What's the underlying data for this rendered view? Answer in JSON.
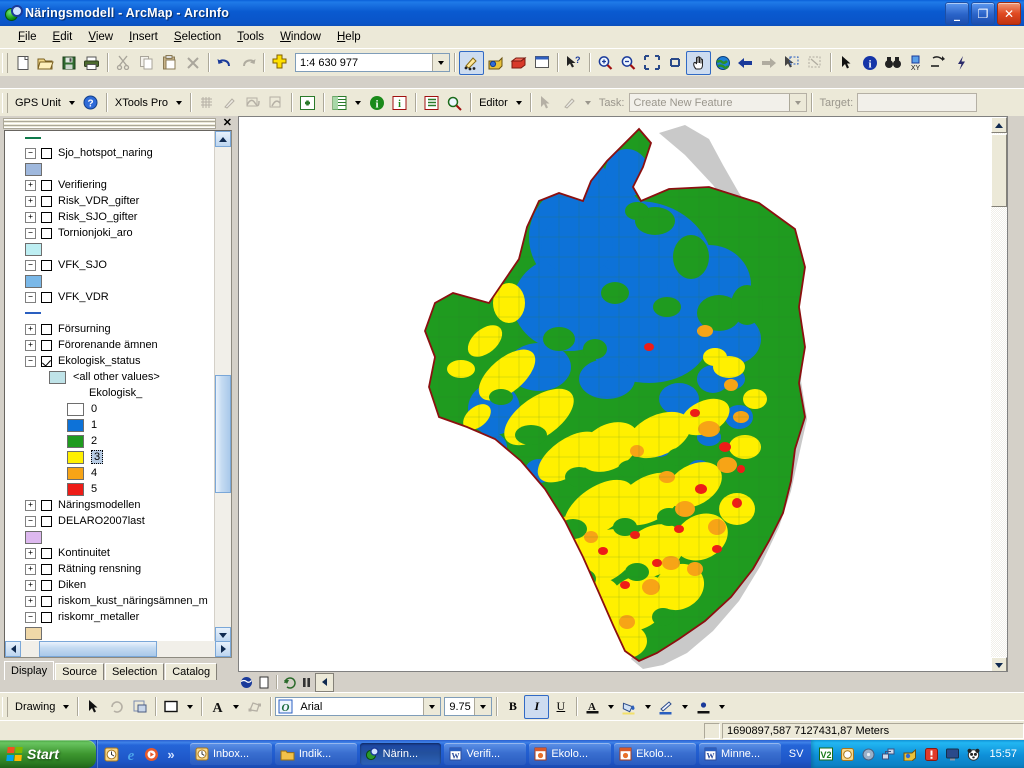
{
  "window": {
    "title": "Näringsmodell - ArcMap - ArcInfo",
    "app_icon": "arcmap-globe-icon",
    "minimize": "_",
    "restore": "❐",
    "close": "✕"
  },
  "menu": {
    "items": [
      "File",
      "Edit",
      "View",
      "Insert",
      "Selection",
      "Tools",
      "Window",
      "Help"
    ]
  },
  "standard_toolbar": {
    "scale_value": "1:4 630 977",
    "buttons": [
      {
        "name": "new-document-button",
        "icon": "page-icon"
      },
      {
        "name": "open-button",
        "icon": "folder-open-icon"
      },
      {
        "name": "save-button",
        "icon": "floppy-disk-icon"
      },
      {
        "name": "print-button",
        "icon": "printer-icon"
      },
      {
        "name": "cut-button",
        "icon": "scissors-icon"
      },
      {
        "name": "copy-button",
        "icon": "copy-icon"
      },
      {
        "name": "paste-button",
        "icon": "clipboard-icon"
      },
      {
        "name": "delete-button",
        "icon": "x-icon"
      },
      {
        "name": "undo-button",
        "icon": "undo-arrow-icon"
      },
      {
        "name": "redo-button",
        "icon": "redo-arrow-icon"
      },
      {
        "name": "add-data-button",
        "icon": "yellow-plus-icon"
      },
      {
        "name": "editor-toolbar-button",
        "icon": "pencil-points-icon"
      },
      {
        "name": "toolbox-button",
        "icon": "toolbox-icon"
      },
      {
        "name": "model-builder-button",
        "icon": "red-box-icon"
      },
      {
        "name": "python-window-button",
        "icon": "window-icon"
      },
      {
        "name": "whats-this-button",
        "icon": "arrow-question-icon"
      }
    ]
  },
  "tools_toolbar": {
    "buttons": [
      {
        "name": "zoom-in-tool",
        "icon": "magnifier-plus-icon"
      },
      {
        "name": "zoom-out-tool",
        "icon": "magnifier-minus-icon"
      },
      {
        "name": "fixed-zoom-in-button",
        "icon": "arrows-in-icon"
      },
      {
        "name": "fixed-zoom-out-button",
        "icon": "arrows-out-icon"
      },
      {
        "name": "pan-tool",
        "icon": "hand-icon",
        "active": true
      },
      {
        "name": "full-extent-button",
        "icon": "globe-icon"
      },
      {
        "name": "previous-extent-button",
        "icon": "left-arrow-icon"
      },
      {
        "name": "next-extent-button",
        "icon": "right-arrow-icon"
      },
      {
        "name": "select-features-tool",
        "icon": "select-arrow-icon"
      },
      {
        "name": "clear-selection-button",
        "icon": "clear-selection-icon"
      },
      {
        "name": "select-elements-tool",
        "icon": "black-arrow-icon"
      },
      {
        "name": "identify-tool",
        "icon": "info-circle-icon"
      },
      {
        "name": "find-button",
        "icon": "binoculars-icon"
      },
      {
        "name": "go-to-xy-button",
        "icon": "xy-icon"
      },
      {
        "name": "measure-tool",
        "icon": "ruler-icon"
      },
      {
        "name": "hyperlink-tool",
        "icon": "lightning-icon"
      }
    ]
  },
  "gps_toolbar": {
    "gps_unit_label": "GPS Unit",
    "help_icon": "blue-question-icon",
    "xtools_label": "XTools Pro"
  },
  "editor_toolbar": {
    "editor_label": "Editor",
    "task_label": "Task:",
    "task_value": "Create New Feature",
    "target_label": "Target:",
    "target_value": ""
  },
  "toc": {
    "close_icon": "close-icon",
    "layers": [
      {
        "id": "top-line",
        "type": "symbol-only",
        "swatch": "line-green"
      },
      {
        "id": "sjo-hotspot-naring",
        "name": "Sjo_hotspot_naring",
        "expand": "-",
        "checked": false,
        "symbols": [
          {
            "color": "#9fb8dd",
            "shape": "fill"
          }
        ]
      },
      {
        "id": "verifiering",
        "name": "Verifiering",
        "expand": "+",
        "checked": false,
        "symbols": []
      },
      {
        "id": "risk-vdr-gifter",
        "name": "Risk_VDR_gifter",
        "expand": "+",
        "checked": false,
        "symbols": []
      },
      {
        "id": "risk-sjo-gifter",
        "name": "Risk_SJO_gifter",
        "expand": "+",
        "checked": false,
        "symbols": []
      },
      {
        "id": "tornionjoki-aro",
        "name": "Tornionjoki_aro",
        "expand": "-",
        "checked": false,
        "symbols": [
          {
            "color": "#bdeef2",
            "shape": "fill"
          }
        ]
      },
      {
        "id": "vfk-sjo",
        "name": "VFK_SJO",
        "expand": "-",
        "checked": false,
        "symbols": [
          {
            "color": "#7ab8e8",
            "shape": "fill"
          }
        ]
      },
      {
        "id": "vfk-vdr",
        "name": "VFK_VDR",
        "expand": "-",
        "checked": false,
        "symbols": [
          {
            "color": "#2a5fc0",
            "shape": "line"
          }
        ]
      },
      {
        "id": "forsurning",
        "name": "Försurning",
        "expand": "+",
        "checked": false,
        "symbols": []
      },
      {
        "id": "fororenande-amnen",
        "name": "Förorenande ämnen",
        "expand": "+",
        "checked": false,
        "symbols": []
      },
      {
        "id": "ekologisk-status",
        "name": "Ekologisk_status",
        "expand": "-",
        "checked": true,
        "symbols": []
      },
      {
        "id": "naringsmodellen",
        "name": "Näringsmodellen",
        "expand": "+",
        "checked": false,
        "symbols": []
      },
      {
        "id": "delaro2007last",
        "name": "DELARO2007last",
        "expand": "-",
        "checked": false,
        "symbols": [
          {
            "color": "#ddb8ef",
            "shape": "fill"
          }
        ]
      },
      {
        "id": "kontinuitet",
        "name": "Kontinuitet",
        "expand": "+",
        "checked": false,
        "symbols": []
      },
      {
        "id": "ratning-rensning",
        "name": "Rätning rensning",
        "expand": "+",
        "checked": false,
        "symbols": []
      },
      {
        "id": "diken",
        "name": "Diken",
        "expand": "+",
        "checked": false,
        "symbols": []
      },
      {
        "id": "riskom-kust",
        "name": "riskom_kust_näringsämnen_m",
        "expand": "+",
        "checked": false,
        "symbols": []
      },
      {
        "id": "riskomr-metaller",
        "name": "riskomr_metaller",
        "expand": "-",
        "checked": false,
        "symbols": [
          {
            "color": "#f0d8a8",
            "shape": "fill"
          }
        ]
      }
    ],
    "ekologisk_legend": {
      "all_other_values": "<all other values>",
      "field_heading": "Ekologisk_",
      "classes": [
        {
          "label": "0",
          "color": "#ffffff",
          "selected": false
        },
        {
          "label": "1",
          "color": "#0d72d8",
          "selected": false
        },
        {
          "label": "2",
          "color": "#1f9b1f",
          "selected": false
        },
        {
          "label": "3",
          "color": "#fff000",
          "selected": true
        },
        {
          "label": "4",
          "color": "#f7a416",
          "selected": false
        },
        {
          "label": "5",
          "color": "#ee1c17",
          "selected": false
        }
      ],
      "other_swatch_color": "#bfe3e8"
    },
    "tabs": [
      {
        "label": "Display",
        "active": true
      },
      {
        "label": "Source",
        "active": false
      },
      {
        "label": "Selection",
        "active": false
      },
      {
        "label": "Catalog",
        "active": false
      }
    ]
  },
  "map": {
    "view_buttons": [
      {
        "name": "data-view-button",
        "icon": "globe-small-icon"
      },
      {
        "name": "layout-view-button",
        "icon": "page-small-icon"
      },
      {
        "name": "refresh-view-button",
        "icon": "refresh-icon"
      },
      {
        "name": "pause-drawing-button",
        "icon": "pause-icon"
      },
      {
        "name": "scroll-left-button",
        "icon": "left-triangle-icon"
      }
    ],
    "boundary_color": "#8b1010",
    "coast_color": "#c9c9c9",
    "background_color": "#ffffff",
    "class_colors": {
      "c1": "#0d72d8",
      "c2": "#1f9b1f",
      "c3": "#fff000",
      "c4": "#f7a416",
      "c5": "#ee1c17"
    }
  },
  "drawing_toolbar": {
    "drawing_label": "Drawing",
    "font_name": "Arial",
    "font_size": "9.75",
    "bold": "B",
    "italic": "I",
    "underline": "U",
    "buttons": [
      {
        "name": "select-elements-tool",
        "icon": "black-arrow-icon"
      },
      {
        "name": "rotate-element-button",
        "icon": "rotate-icon"
      },
      {
        "name": "new-graphic-button",
        "icon": "graphic-icon"
      },
      {
        "name": "draw-rectangle-button",
        "icon": "rectangle-icon"
      },
      {
        "name": "new-text-button",
        "icon": "text-a-icon"
      },
      {
        "name": "edit-vertices-button",
        "icon": "vertices-icon"
      },
      {
        "name": "font-color-button",
        "icon": "font-color-icon"
      },
      {
        "name": "fill-color-button",
        "icon": "fill-bucket-icon"
      },
      {
        "name": "line-color-button",
        "icon": "line-pen-icon"
      },
      {
        "name": "marker-color-button",
        "icon": "marker-dot-icon"
      }
    ]
  },
  "status_bar": {
    "coordinates": "1690897,587  7127431,87 Meters"
  },
  "taskbar": {
    "start_label": "Start",
    "quick_launch": [
      {
        "name": "ql-clock-icon",
        "glyph": "◴"
      },
      {
        "name": "ql-internet-explorer-icon",
        "glyph": "e"
      },
      {
        "name": "ql-media-player-icon",
        "glyph": "▶"
      },
      {
        "name": "ql-more-icon",
        "glyph": "»"
      }
    ],
    "items": [
      {
        "label": "Inbox...",
        "icon": "outlook-icon",
        "active": false
      },
      {
        "label": "Indik...",
        "icon": "folder-icon",
        "active": false
      },
      {
        "label": "Närin...",
        "icon": "arcmap-icon",
        "active": true
      },
      {
        "label": "Verifi...",
        "icon": "word-icon",
        "active": false
      },
      {
        "label": "Ekolo...",
        "icon": "powerpoint-icon",
        "active": false
      },
      {
        "label": "Ekolo...",
        "icon": "powerpoint-icon",
        "active": false
      },
      {
        "label": "Minne...",
        "icon": "word-icon",
        "active": false
      }
    ],
    "language": "SV",
    "tray_icons": [
      {
        "name": "tray-antivirus-icon"
      },
      {
        "name": "tray-clock-icon"
      },
      {
        "name": "tray-disc-icon"
      },
      {
        "name": "tray-network-icon"
      },
      {
        "name": "tray-arcgis-icon"
      },
      {
        "name": "tray-alert-icon"
      },
      {
        "name": "tray-display-icon"
      },
      {
        "name": "tray-panda-icon"
      }
    ],
    "clock": "15:57"
  }
}
